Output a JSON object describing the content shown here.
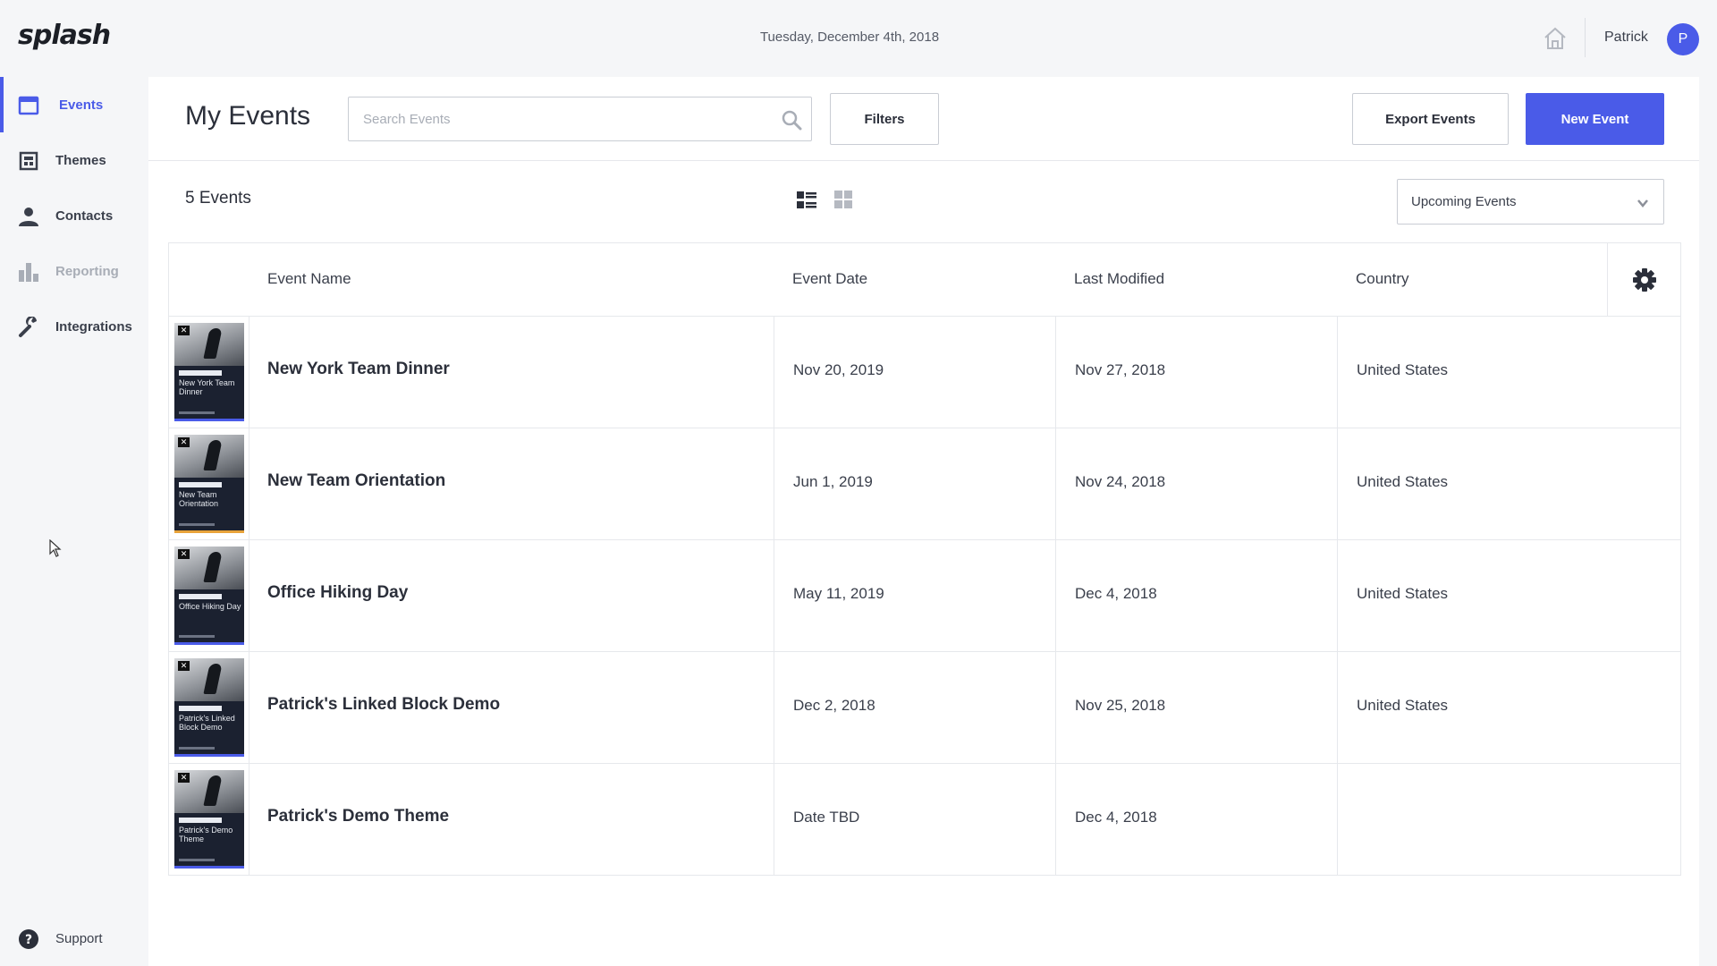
{
  "app": {
    "logo": "splash",
    "date": "Tuesday, December 4th, 2018"
  },
  "user": {
    "name": "Patrick",
    "initial": "P"
  },
  "sidebar": {
    "items": [
      {
        "label": "Events",
        "icon": "calendar-icon",
        "state": "active"
      },
      {
        "label": "Themes",
        "icon": "theme-icon",
        "state": "normal"
      },
      {
        "label": "Contacts",
        "icon": "person-icon",
        "state": "normal"
      },
      {
        "label": "Reporting",
        "icon": "bar-chart-icon",
        "state": "disabled"
      },
      {
        "label": "Integrations",
        "icon": "wrench-icon",
        "state": "normal"
      }
    ],
    "support": {
      "label": "Support",
      "icon": "help-icon"
    }
  },
  "header": {
    "title": "My Events",
    "search_placeholder": "Search Events",
    "filters_label": "Filters",
    "export_label": "Export Events",
    "new_label": "New Event"
  },
  "toolbar": {
    "count": "5 Events",
    "range_selected": "Upcoming Events"
  },
  "table": {
    "columns": [
      "Event Name",
      "Event Date",
      "Last Modified",
      "Country"
    ],
    "rows": [
      {
        "name": "New York Team Dinner",
        "date": "Nov 20, 2019",
        "modified": "Nov 27, 2018",
        "country": "United States",
        "thumb_title": "New York Team Dinner",
        "accent": "blue"
      },
      {
        "name": "New Team Orientation",
        "date": "Jun 1, 2019",
        "modified": "Nov 24, 2018",
        "country": "United States",
        "thumb_title": "New Team Orientation",
        "accent": "orange"
      },
      {
        "name": "Office Hiking Day",
        "date": "May 11, 2019",
        "modified": "Dec 4, 2018",
        "country": "United States",
        "thumb_title": "Office Hiking Day",
        "accent": "blue"
      },
      {
        "name": "Patrick's Linked Block Demo",
        "date": "Dec 2, 2018",
        "modified": "Nov 25, 2018",
        "country": "United States",
        "thumb_title": "Patrick's Linked Block Demo",
        "accent": "blue"
      },
      {
        "name": "Patrick's Demo Theme",
        "date": "Date TBD",
        "modified": "Dec 4, 2018",
        "country": "",
        "thumb_title": "Patrick's Demo Theme",
        "accent": "blue"
      }
    ]
  },
  "colors": {
    "accent": "#4a5be8",
    "text": "#2b2f3a",
    "border": "#e6e8ec"
  }
}
